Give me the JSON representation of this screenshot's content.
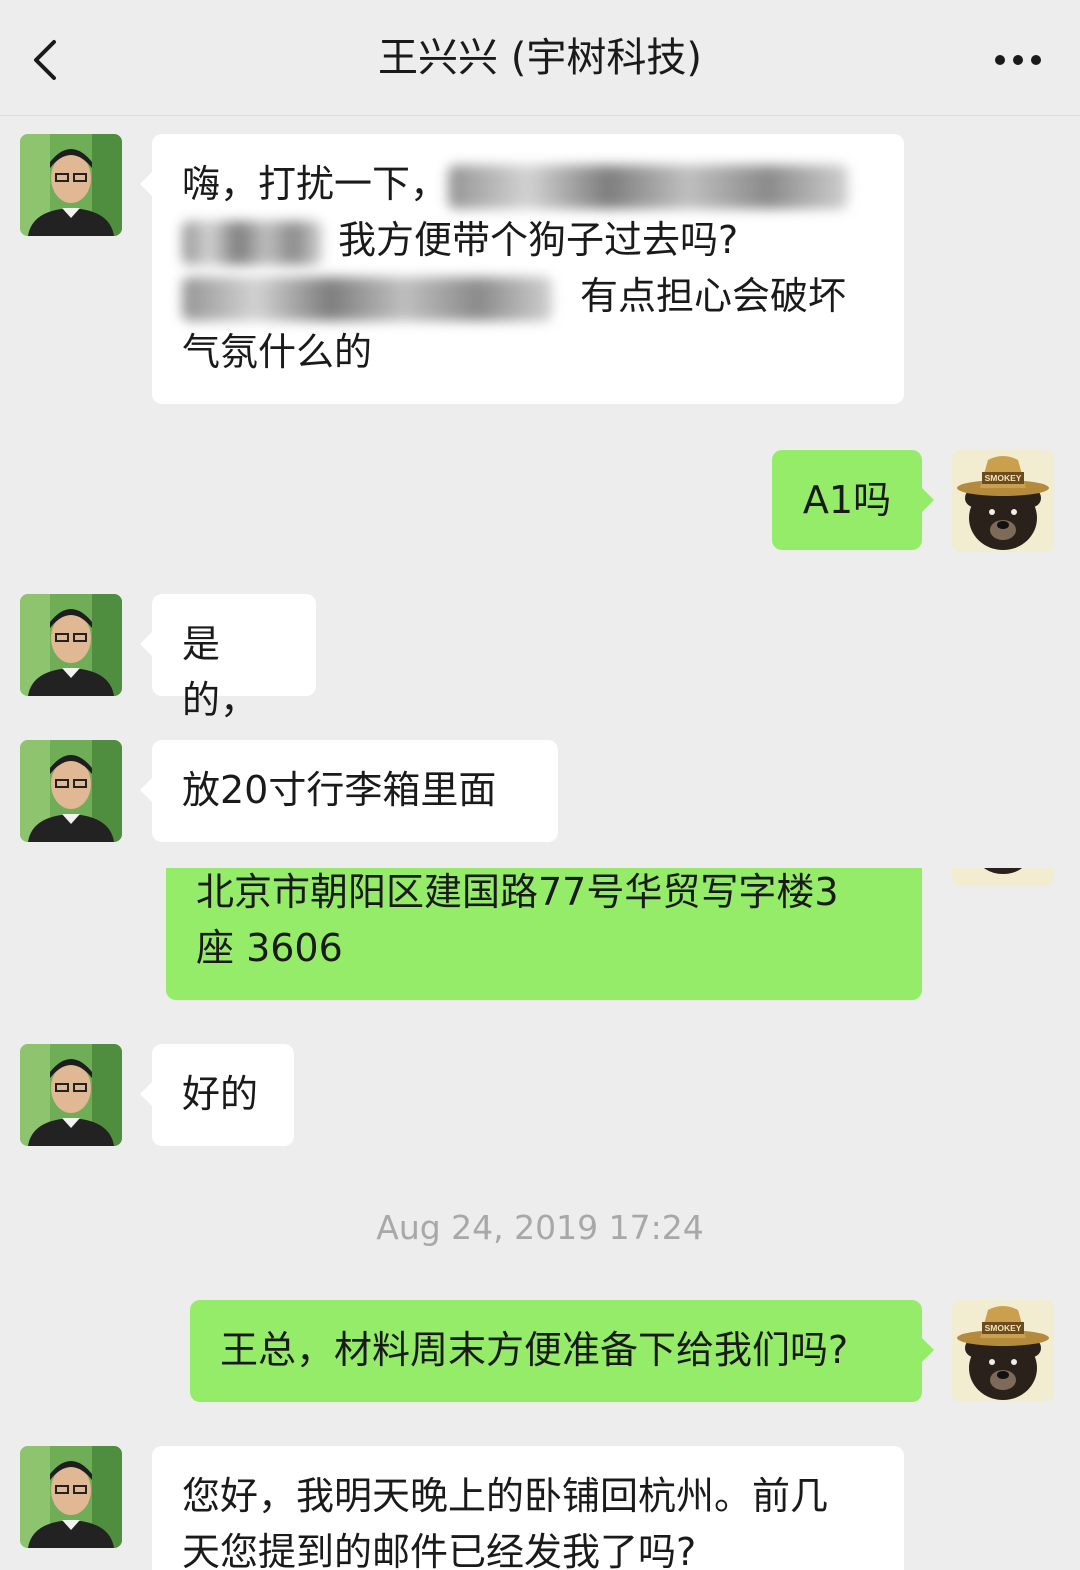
{
  "header": {
    "title": "王兴兴 (宇树科技)",
    "back_icon": "chevron-left-icon",
    "more_icon": "more-dots-icon"
  },
  "colors": {
    "background": "#ededed",
    "incoming_bubble": "#ffffff",
    "outgoing_bubble": "#95ec69",
    "timestamp_text": "#a8a8a8"
  },
  "messages": [
    {
      "side": "in",
      "lines": [
        "嗨，打扰一下，",
        "我方便带个狗子过去吗?",
        "有点担心会破坏",
        "气氛什么的"
      ]
    },
    {
      "side": "out",
      "text": "A1吗"
    },
    {
      "side": "in",
      "text": "是的，"
    },
    {
      "side": "in",
      "text": "放20寸行李箱里面"
    },
    {
      "side": "out",
      "lines": [
        "北京市朝阳区建国路77号华贸写字楼3",
        "座 3606"
      ]
    },
    {
      "side": "in",
      "text": "好的"
    },
    {
      "side": "timestamp",
      "text": "Aug 24, 2019 17:24"
    },
    {
      "side": "out",
      "text": "王总，材料周末方便准备下给我们吗?"
    },
    {
      "side": "in",
      "lines": [
        "您好，我明天晚上的卧铺回杭州。前几",
        "天您提到的邮件已经发我了吗?"
      ]
    }
  ],
  "avatars": {
    "contact": "man-portrait-avatar",
    "self": "smokey-bear-avatar",
    "self_hat_text": "SMOKEY"
  }
}
